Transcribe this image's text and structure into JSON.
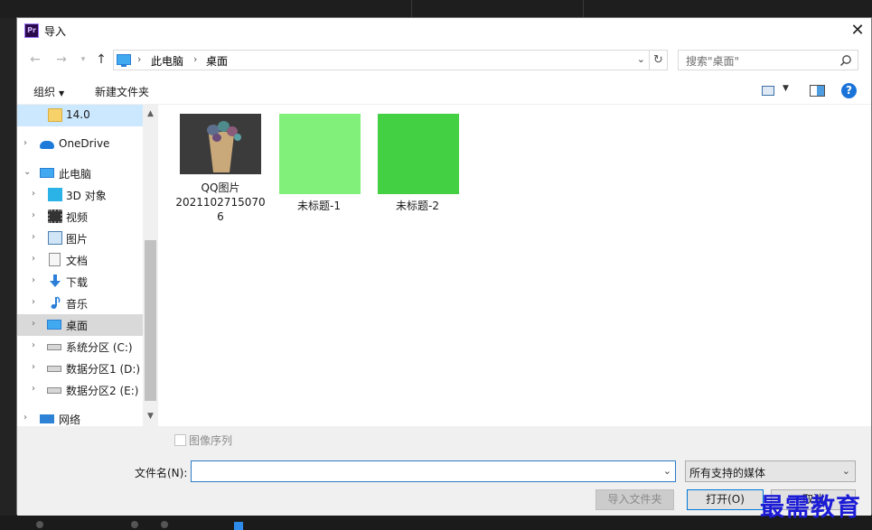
{
  "window": {
    "app_icon": "premiere-pro-icon",
    "app_icon_text": "Pr",
    "title": "导入",
    "close_icon": "close-icon"
  },
  "navigation": {
    "back_icon": "arrow-left-icon",
    "forward_icon": "arrow-right-icon",
    "recent_icon": "chevron-down-icon",
    "up_icon": "arrow-up-icon",
    "address": {
      "breadcrumbs": [
        "此电脑",
        "桌面"
      ]
    },
    "refresh_icon": "refresh-icon",
    "search": {
      "placeholder": "搜索\"桌面\"",
      "icon": "search-icon"
    }
  },
  "toolbar": {
    "organize_label": "组织",
    "new_folder_label": "新建文件夹",
    "view_icon": "view-mode-icon",
    "preview_pane_icon": "preview-pane-icon",
    "help_icon": "help-icon",
    "help_text": "?"
  },
  "sidebar": {
    "items": [
      {
        "label": "14.0",
        "icon": "folder-icon"
      },
      {
        "label": "OneDrive",
        "icon": "onedrive-icon"
      },
      {
        "label": "此电脑",
        "icon": "computer-icon"
      },
      {
        "label": "3D 对象",
        "icon": "3d-objects-icon"
      },
      {
        "label": "视频",
        "icon": "video-icon"
      },
      {
        "label": "图片",
        "icon": "pictures-icon"
      },
      {
        "label": "文档",
        "icon": "documents-icon"
      },
      {
        "label": "下载",
        "icon": "download-icon"
      },
      {
        "label": "音乐",
        "icon": "music-icon"
      },
      {
        "label": "桌面",
        "icon": "desktop-icon"
      },
      {
        "label": "系统分区 (C:)",
        "icon": "system-drive-icon"
      },
      {
        "label": "数据分区1 (D:)",
        "icon": "drive-icon"
      },
      {
        "label": "数据分区2 (E:)",
        "icon": "drive-icon"
      },
      {
        "label": "网络",
        "icon": "network-icon"
      }
    ],
    "selected": "桌面"
  },
  "files": [
    {
      "name": "QQ图片20211027150706",
      "name_lines": [
        "QQ图片",
        "2021102715070",
        "6"
      ],
      "thumbnail": "photo-flower-bouquet"
    },
    {
      "name": "未标题-1",
      "name_lines": [
        "未标题-1"
      ],
      "thumbnail": "solid",
      "color": "#80f07a"
    },
    {
      "name": "未标题-2",
      "name_lines": [
        "未标题-2"
      ],
      "thumbnail": "solid",
      "color": "#43d043"
    }
  ],
  "bottom": {
    "image_sequence_label": "图像序列",
    "image_sequence_checked": false,
    "filename_label": "文件名(N):",
    "filename_value": "",
    "filter_value": "所有支持的媒体",
    "import_folder_label": "导入文件夹",
    "open_label": "打开(O)",
    "cancel_label": "取消"
  },
  "watermark": "最需教育",
  "colors": {
    "selection": "#cce8ff",
    "accent": "#0078d7",
    "help": "#1a73d8"
  }
}
